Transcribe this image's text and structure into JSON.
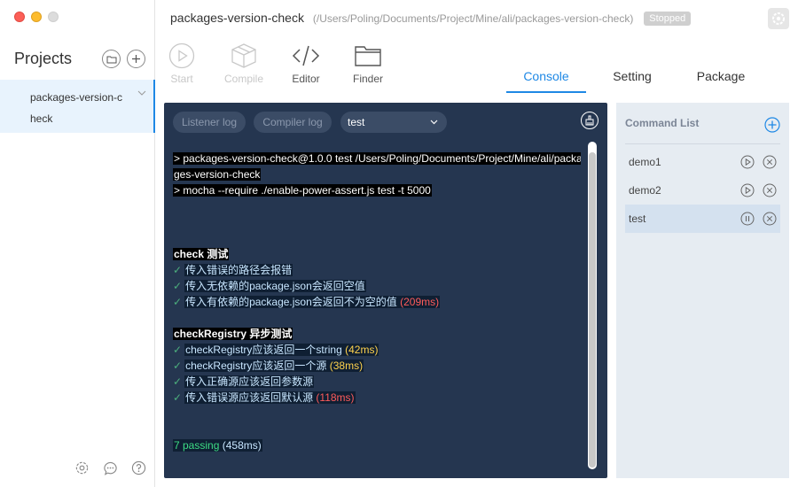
{
  "sidebar": {
    "title": "Projects",
    "projects": [
      {
        "name": "packages-version-check"
      }
    ],
    "footer_icons": [
      "gear-icon",
      "chat-icon",
      "help-icon"
    ]
  },
  "header": {
    "project_name": "packages-version-check",
    "project_path": "(/Users/Poling/Documents/Project/Mine/ali/packages-version-check)",
    "status": "Stopped"
  },
  "toolbar": {
    "start": "Start",
    "compile": "Compile",
    "editor": "Editor",
    "finder": "Finder"
  },
  "tabs": [
    {
      "label": "Console",
      "active": true
    },
    {
      "label": "Setting",
      "active": false
    },
    {
      "label": "Package",
      "active": false
    }
  ],
  "console": {
    "listener_log": "Listener log",
    "compiler_log": "Compiler log",
    "selected_command": "test",
    "lines": {
      "cmd1a": "> packages-version-check@1.0.0 test /Users/Poling/Documents/Project/Mine/ali/packa",
      "cmd1b": "ges-version-check",
      "cmd2": "> mocha --require ./enable-power-assert.js test -t 5000",
      "suite1": "check 测试",
      "s1t1": "传入错误的路径会报错",
      "s1t2": "传入无依赖的package.json会返回空值",
      "s1t3": "传入有依赖的package.json会返回不为空的值",
      "s1t3_time": "(209ms)",
      "suite2": "checkRegistry 异步测试",
      "s2t1": "checkRegistry应该返回一个string",
      "s2t1_time": "(42ms)",
      "s2t2": "checkRegistry应该返回一个源",
      "s2t2_time": "(38ms)",
      "s2t3": "传入正确源应该返回参数源",
      "s2t4": "传入错误源应该返回默认源",
      "s2t4_time": "(118ms)",
      "passing": "7 passing",
      "passing_time": "(458ms)",
      "check_mark": "✓"
    }
  },
  "command_list": {
    "title": "Command List",
    "commands": [
      {
        "name": "demo1",
        "state": "stopped"
      },
      {
        "name": "demo2",
        "state": "stopped"
      },
      {
        "name": "test",
        "state": "running"
      }
    ]
  },
  "colors": {
    "accent": "#1e88e5",
    "console_bg": "#253650",
    "time_red": "#ff5b5b",
    "time_yellow": "#ffd34d",
    "passing_green": "#3ddc84"
  }
}
